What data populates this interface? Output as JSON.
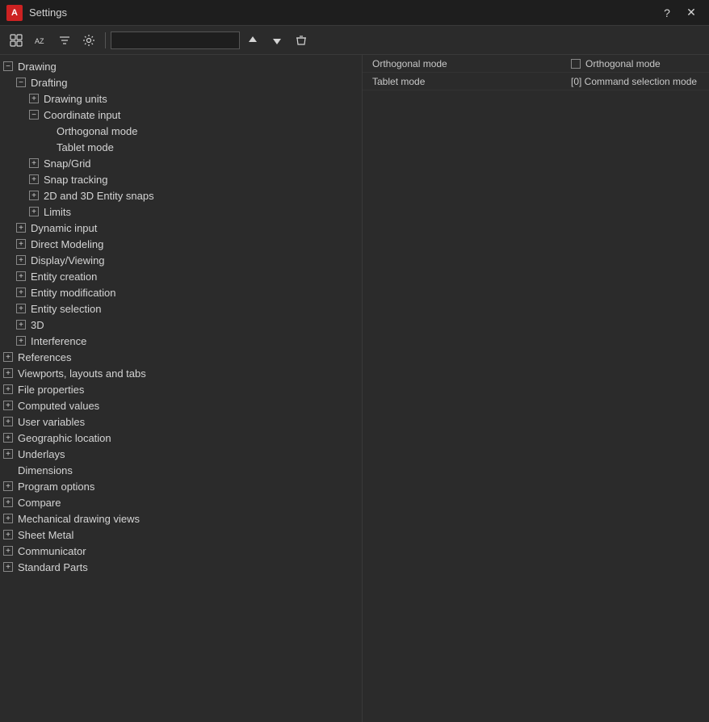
{
  "window": {
    "title": "Settings",
    "icon_label": "A"
  },
  "toolbar": {
    "btn1_label": "⊞",
    "btn2_label": "AZ",
    "btn3_label": "≡",
    "btn4_label": "⚙",
    "search_placeholder": "",
    "btn_up_label": "↑",
    "btn_down_label": "↓",
    "btn_clear_label": "✕"
  },
  "tree": {
    "items": [
      {
        "id": "drawing",
        "label": "Drawing",
        "indent": 0,
        "type": "minus"
      },
      {
        "id": "drafting",
        "label": "Drafting",
        "indent": 1,
        "type": "minus"
      },
      {
        "id": "drawing_units",
        "label": "Drawing units",
        "indent": 2,
        "type": "plus"
      },
      {
        "id": "coord_input",
        "label": "Coordinate input",
        "indent": 2,
        "type": "minus"
      },
      {
        "id": "orthogonal_mode",
        "label": "Orthogonal mode",
        "indent": 3,
        "type": "none"
      },
      {
        "id": "tablet_mode",
        "label": "Tablet mode",
        "indent": 3,
        "type": "none"
      },
      {
        "id": "snap_grid",
        "label": "Snap/Grid",
        "indent": 2,
        "type": "plus"
      },
      {
        "id": "snap_tracking",
        "label": "Snap tracking",
        "indent": 2,
        "type": "plus"
      },
      {
        "id": "entity_snaps",
        "label": "2D and 3D Entity snaps",
        "indent": 2,
        "type": "plus"
      },
      {
        "id": "limits",
        "label": "Limits",
        "indent": 2,
        "type": "plus"
      },
      {
        "id": "dynamic_input",
        "label": "Dynamic input",
        "indent": 1,
        "type": "plus"
      },
      {
        "id": "direct_modeling",
        "label": "Direct Modeling",
        "indent": 1,
        "type": "plus"
      },
      {
        "id": "display_viewing",
        "label": "Display/Viewing",
        "indent": 1,
        "type": "plus"
      },
      {
        "id": "entity_creation",
        "label": "Entity creation",
        "indent": 1,
        "type": "plus"
      },
      {
        "id": "entity_modification",
        "label": "Entity modification",
        "indent": 1,
        "type": "plus"
      },
      {
        "id": "entity_selection",
        "label": "Entity selection",
        "indent": 1,
        "type": "plus"
      },
      {
        "id": "3d",
        "label": "3D",
        "indent": 1,
        "type": "plus"
      },
      {
        "id": "interference",
        "label": "Interference",
        "indent": 1,
        "type": "plus"
      },
      {
        "id": "references",
        "label": "References",
        "indent": 0,
        "type": "plus"
      },
      {
        "id": "viewports_layouts",
        "label": "Viewports, layouts and tabs",
        "indent": 0,
        "type": "plus"
      },
      {
        "id": "file_properties",
        "label": "File properties",
        "indent": 0,
        "type": "plus"
      },
      {
        "id": "computed_values",
        "label": "Computed values",
        "indent": 0,
        "type": "plus"
      },
      {
        "id": "user_variables",
        "label": "User variables",
        "indent": 0,
        "type": "plus"
      },
      {
        "id": "geographic_location",
        "label": "Geographic location",
        "indent": 0,
        "type": "plus"
      },
      {
        "id": "underlays",
        "label": "Underlays",
        "indent": 0,
        "type": "plus"
      },
      {
        "id": "dimensions",
        "label": "Dimensions",
        "indent": 0,
        "type": "none"
      },
      {
        "id": "program_options",
        "label": "Program options",
        "indent": 0,
        "type": "plus"
      },
      {
        "id": "compare",
        "label": "Compare",
        "indent": 0,
        "type": "plus"
      },
      {
        "id": "mechanical_drawing",
        "label": "Mechanical drawing views",
        "indent": 0,
        "type": "plus"
      },
      {
        "id": "sheet_metal",
        "label": "Sheet Metal",
        "indent": 0,
        "type": "plus"
      },
      {
        "id": "communicator",
        "label": "Communicator",
        "indent": 0,
        "type": "plus"
      },
      {
        "id": "standard_parts",
        "label": "Standard Parts",
        "indent": 0,
        "type": "plus"
      }
    ]
  },
  "settings_rows": [
    {
      "key": "Orthogonal mode",
      "value_type": "checkbox_text",
      "text": "Orthogonal mode"
    },
    {
      "key": "Tablet mode",
      "value_type": "text",
      "text": "[0] Command selection mode"
    }
  ]
}
